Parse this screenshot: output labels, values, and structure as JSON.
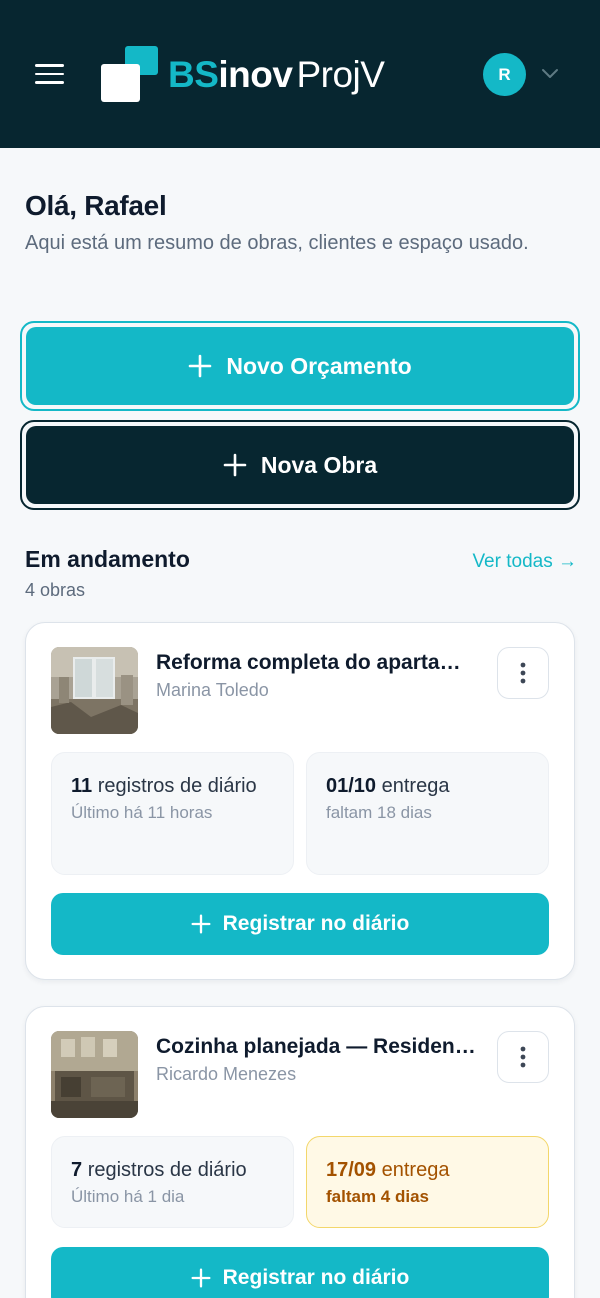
{
  "header": {
    "logo_bs": "BS",
    "logo_inov": "inov",
    "logo_proj": "ProjV",
    "avatar_initial": "R",
    "icons": {
      "menu": "hamburger-menu-icon",
      "account_dropdown": "chevron-down-icon"
    }
  },
  "greeting": {
    "title": "Olá, Rafael",
    "subtitle": "Aqui está um resumo de obras, clientes e espaço usado."
  },
  "actions": {
    "new_budget": "Novo Orçamento",
    "new_work": "Nova Obra"
  },
  "section": {
    "title": "Em andamento",
    "count": "4 obras",
    "see_all": "Ver todas →"
  },
  "cards": [
    {
      "title": "Reforma completa do apartamento",
      "client": "Marina Toledo",
      "log_count": "11",
      "log_label": "registros de diário",
      "log_last": "Último há 11 horas",
      "delivery_date": "01/10",
      "delivery_label": "entrega",
      "delivery_remaining": "faltam 18 dias",
      "delivery_status": "normal",
      "register_label": "Registrar no diário"
    },
    {
      "title": "Cozinha planejada — Residencial",
      "client": "Ricardo Menezes",
      "log_count": "7",
      "log_label": "registros de diário",
      "log_last": "Último há 1 dia",
      "delivery_date": "17/09",
      "delivery_label": "entrega",
      "delivery_remaining": "faltam 4 dias",
      "delivery_status": "warning",
      "register_label": "Registrar no diário"
    }
  ],
  "colors": {
    "header_bg": "#072630",
    "accent": "#14b8c7",
    "warning_bg": "#fff9e6",
    "warning_text": "#a35200"
  }
}
